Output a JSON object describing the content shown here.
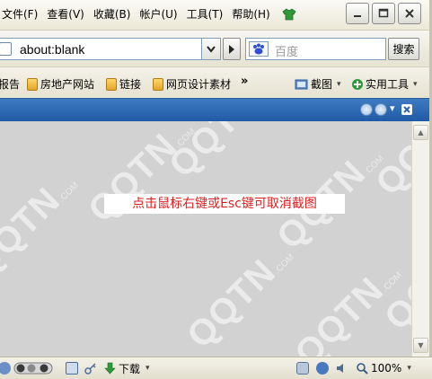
{
  "menu": {
    "items": [
      "文件(F)",
      "查看(V)",
      "收藏(B)",
      "帐户(U)",
      "工具(T)",
      "帮助(H)"
    ]
  },
  "address": {
    "url": "about:blank"
  },
  "search": {
    "placeholder": "百度",
    "button_label": "搜索"
  },
  "favorites": {
    "items": [
      "报告",
      "房地产网站",
      "链接",
      "网页设计素材"
    ],
    "more": "»",
    "screenshot_label": "截图",
    "tools_label": "实用工具"
  },
  "content": {
    "hint": "点击鼠标右键或Esc键可取消截图",
    "watermark": "QQTN",
    "watermark_suffix": ".COM",
    "background_color": "#d2d2d2",
    "hint_color": "#e02020"
  },
  "status": {
    "download_label": "下载",
    "zoom": "100%"
  },
  "theme": {
    "accent": "#2b62ad"
  }
}
